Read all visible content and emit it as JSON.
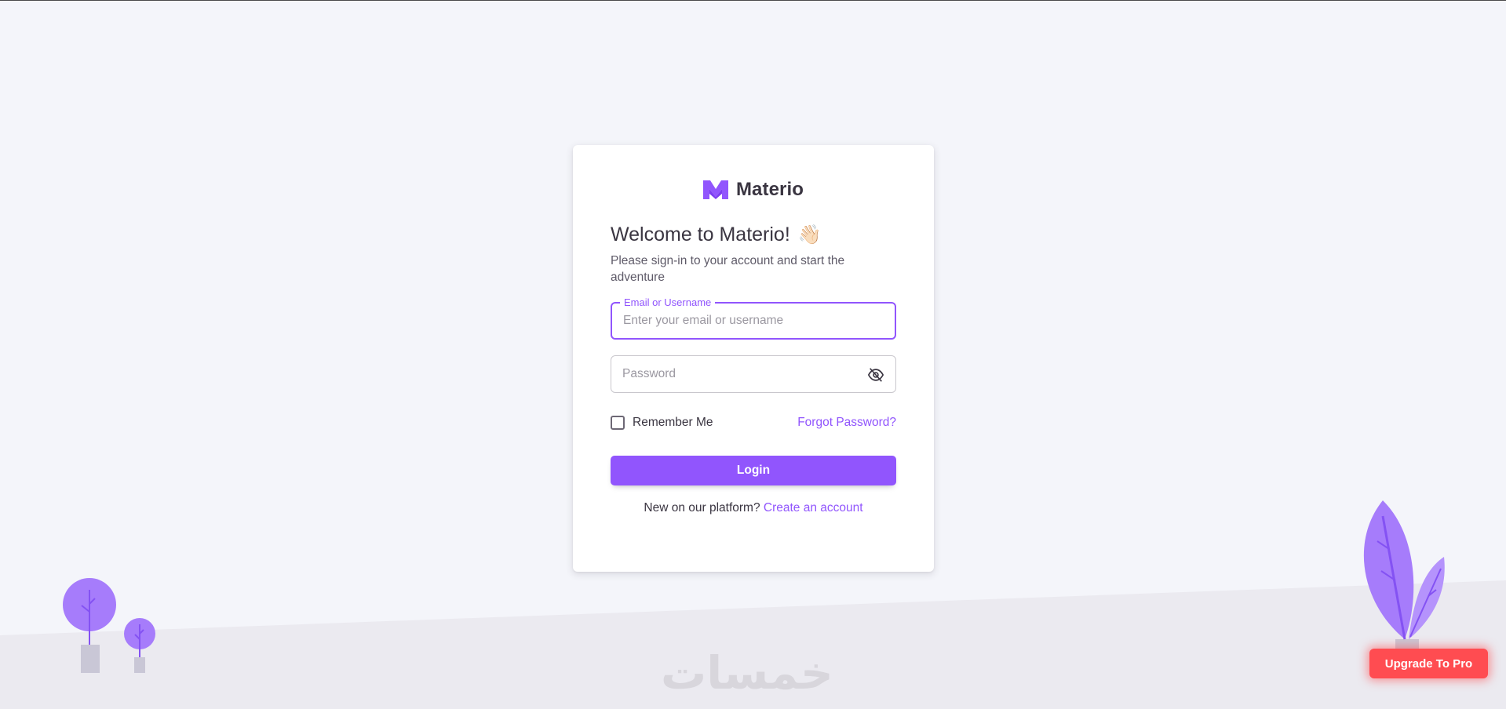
{
  "brand": {
    "name": "Materio",
    "logo_icon": "materio-m-logo-icon"
  },
  "welcome": {
    "title": "Welcome to Materio!",
    "emoji": "👋🏻",
    "subtitle": "Please sign-in to your account and start the adventure"
  },
  "email": {
    "label": "Email or Username",
    "placeholder": "Enter your email or username",
    "value": ""
  },
  "password": {
    "placeholder": "Password",
    "value": "",
    "toggle_icon": "eye-off-icon"
  },
  "remember": {
    "label": "Remember Me",
    "checked": false
  },
  "forgot": {
    "label": "Forgot Password?"
  },
  "login": {
    "label": "Login"
  },
  "signup": {
    "prompt": "New on our platform?",
    "link": "Create an account"
  },
  "upgrade": {
    "label": "Upgrade To Pro"
  },
  "watermark": {
    "text": "خمسات"
  },
  "colors": {
    "primary": "#9155fd",
    "upgrade": "#ff4c51",
    "background": "#f4f5fa"
  }
}
